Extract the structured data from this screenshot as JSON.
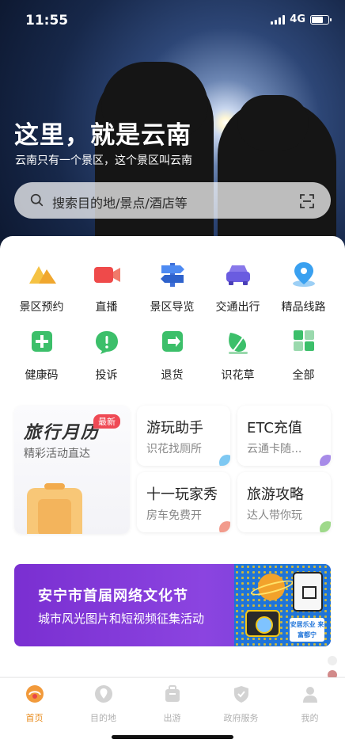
{
  "status_bar": {
    "time": "11:55",
    "network": "4G",
    "battery_level": 0.7
  },
  "hero": {
    "title": "这里，就是云南",
    "subtitle": "云南只有一个景区，这个景区叫云南"
  },
  "search": {
    "placeholder": "搜索目的地/景点/酒店等",
    "left_icon": "search-icon",
    "right_icon": "scan-icon"
  },
  "quick_actions": [
    {
      "label": "景区预约",
      "icon": "mountain-icon",
      "color": "#f3b53a"
    },
    {
      "label": "直播",
      "icon": "video-camera-icon",
      "color": "#ef4a4a"
    },
    {
      "label": "景区导览",
      "icon": "signpost-icon",
      "color": "#3d7df0"
    },
    {
      "label": "交通出行",
      "icon": "car-icon",
      "color": "#6a5ce0"
    },
    {
      "label": "精品线路",
      "icon": "map-pin-icon",
      "color": "#39a0f0"
    },
    {
      "label": "健康码",
      "icon": "health-plus-icon",
      "color": "#3cbf6a"
    },
    {
      "label": "投诉",
      "icon": "complaint-icon",
      "color": "#3cbf6a"
    },
    {
      "label": "退货",
      "icon": "return-icon",
      "color": "#3cbf6a"
    },
    {
      "label": "识花草",
      "icon": "leaf-icon",
      "color": "#3cbf6a"
    },
    {
      "label": "全部",
      "icon": "grid-icon",
      "color": "#3cbf6a"
    }
  ],
  "featured": {
    "title": "旅行月历",
    "badge": "最新",
    "subtitle": "精彩活动直达",
    "cards": [
      {
        "title": "游玩助手",
        "subtitle": "识花找厕所",
        "accent": "#7ec8f2"
      },
      {
        "title": "ETC充值",
        "subtitle": "云通卡随...",
        "accent": "#a78be8"
      },
      {
        "title": "十一玩家秀",
        "subtitle": "房车免费开",
        "accent": "#f29b8c"
      },
      {
        "title": "旅游攻略",
        "subtitle": "达人带你玩",
        "accent": "#9ed98a"
      }
    ]
  },
  "banner": {
    "title": "安宁市首届网络文化节",
    "subtitle": "城市风光图片和短视频征集活动",
    "stamp": "安居乐业 来富都宁"
  },
  "tabbar": [
    {
      "label": "首页",
      "icon": "home-icon",
      "active": true
    },
    {
      "label": "目的地",
      "icon": "destination-icon",
      "active": false
    },
    {
      "label": "出游",
      "icon": "luggage-icon",
      "active": false
    },
    {
      "label": "政府服务",
      "icon": "shield-icon",
      "active": false
    },
    {
      "label": "我的",
      "icon": "user-icon",
      "active": false
    }
  ],
  "colors": {
    "accent": "#e88c1e",
    "banner": "#8b44e0"
  }
}
